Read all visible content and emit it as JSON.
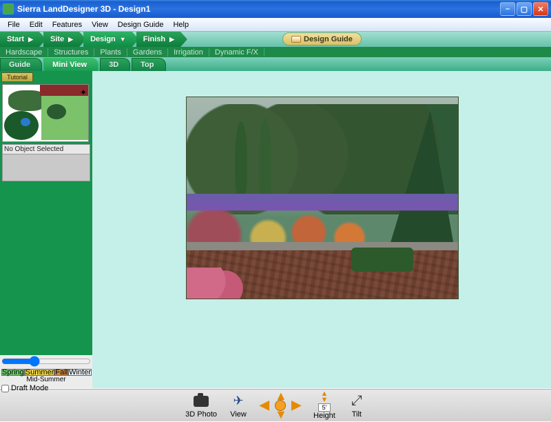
{
  "titlebar": {
    "text": "Sierra LandDesigner 3D - Design1"
  },
  "menubar": [
    "File",
    "Edit",
    "Features",
    "View",
    "Design Guide",
    "Help"
  ],
  "phases": {
    "items": [
      "Start",
      "Site",
      "Design",
      "Finish"
    ],
    "active_index": 2,
    "design_guide_label": "Design Guide"
  },
  "subtabs": [
    "Hardscape",
    "Structures",
    "Plants",
    "Gardens",
    "Irrigation",
    "Dynamic F/X"
  ],
  "viewtabs": {
    "items": [
      "Guide",
      "Mini View",
      "3D",
      "Top"
    ],
    "active_index": 1
  },
  "sidebar": {
    "tutorial_label": "Tutorial",
    "selection_text": "No Object Selected",
    "season": {
      "labels": [
        "Spring",
        "Summer",
        "Fall",
        "Winter"
      ],
      "colors": [
        "#6fd070",
        "#f5da4a",
        "#d08a40",
        "#e8f2f8"
      ],
      "caption": "Mid-Summer",
      "slider_value": 35
    },
    "draft_mode_label": "Draft Mode"
  },
  "bottom_tools": {
    "photo": "3D Photo",
    "view": "View",
    "height_label": "Height",
    "height_value": "5'",
    "tilt": "Tilt"
  }
}
